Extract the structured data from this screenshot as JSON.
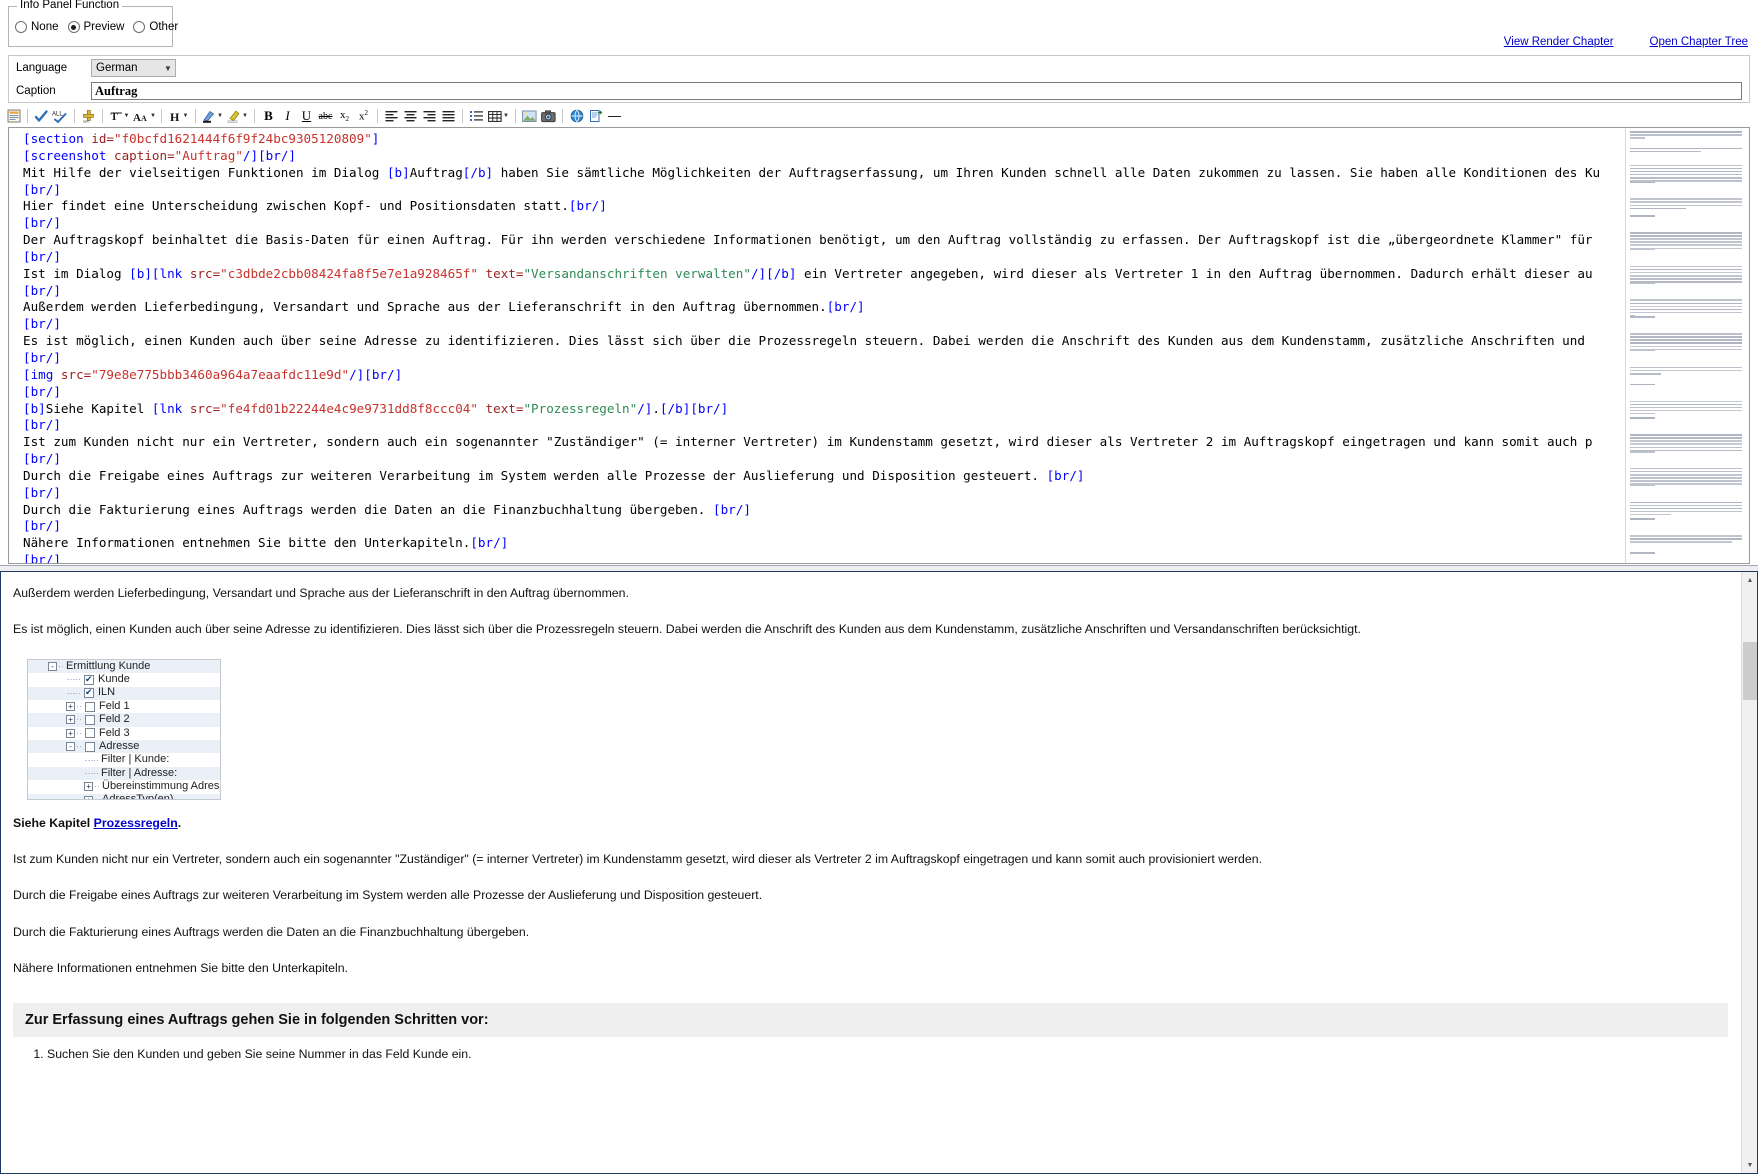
{
  "info_panel": {
    "group_title": "Info Panel Function",
    "options": [
      {
        "label": "None",
        "selected": false
      },
      {
        "label": "Preview",
        "selected": true
      },
      {
        "label": "Other",
        "selected": false
      }
    ]
  },
  "top_links": [
    {
      "label": "View Render Chapter"
    },
    {
      "label": "Open Chapter Tree"
    }
  ],
  "form": {
    "language_label": "Language",
    "language_value": "German",
    "caption_label": "Caption",
    "caption_value": "Auftrag",
    "caption_placeholder": ""
  },
  "toolbar": {
    "buttons": [
      {
        "name": "insert-section-icon",
        "title": "Insert Section"
      },
      {
        "name": "spellcheck-icon",
        "title": "Spell Check"
      },
      {
        "name": "spellcheck-all-icon",
        "title": "Spell Check All"
      },
      {
        "name": "insert-section-marker-icon",
        "title": "Insert Section Marker"
      },
      {
        "name": "font-color-icon",
        "title": "Font"
      },
      {
        "name": "font-size-icon",
        "title": "Font Size"
      },
      {
        "name": "heading-icon",
        "title": "Heading"
      },
      {
        "name": "highlight-pen-icon",
        "title": "Highlight"
      },
      {
        "name": "text-highlight-icon",
        "title": "Text Highlight Color"
      },
      {
        "name": "bold-icon",
        "title": "Bold",
        "glyph": "B"
      },
      {
        "name": "italic-icon",
        "title": "Italic",
        "glyph": "I"
      },
      {
        "name": "underline-icon",
        "title": "Underline",
        "glyph": "U"
      },
      {
        "name": "strikethrough-icon",
        "title": "Strikethrough",
        "glyph": "abc"
      },
      {
        "name": "subscript-icon",
        "title": "Subscript",
        "glyph": "x₂"
      },
      {
        "name": "superscript-icon",
        "title": "Superscript",
        "glyph": "x²"
      },
      {
        "name": "align-left-icon",
        "title": "Align Left"
      },
      {
        "name": "align-center-icon",
        "title": "Align Center"
      },
      {
        "name": "align-right-icon",
        "title": "Align Right"
      },
      {
        "name": "align-justify-icon",
        "title": "Justify"
      },
      {
        "name": "bullet-list-icon",
        "title": "Bullet List"
      },
      {
        "name": "table-icon",
        "title": "Insert Table"
      },
      {
        "name": "insert-image-icon",
        "title": "Insert Image"
      },
      {
        "name": "insert-screenshot-icon",
        "title": "Insert Screenshot"
      },
      {
        "name": "insert-link-icon",
        "title": "Insert Link"
      },
      {
        "name": "insert-reference-icon",
        "title": "Insert Reference"
      },
      {
        "name": "horizontal-rule-icon",
        "title": "Horizontal Rule",
        "glyph": "—"
      }
    ]
  },
  "editor": {
    "lines": [
      [
        {
          "t": "tag",
          "v": "[section "
        },
        {
          "t": "attr",
          "v": "id="
        },
        {
          "t": "str",
          "v": "\"f0bcfd1621444f6f9f24bc9305120809\""
        },
        {
          "t": "tag",
          "v": "]"
        }
      ],
      [
        {
          "t": "tag",
          "v": "[screenshot "
        },
        {
          "t": "attr",
          "v": "caption="
        },
        {
          "t": "str",
          "v": "\"Auftrag\""
        },
        {
          "t": "tag",
          "v": "/]"
        },
        {
          "t": "br",
          "v": "[br/]"
        }
      ],
      [
        {
          "t": "plain",
          "v": "Mit Hilfe der vielseitigen Funktionen im Dialog "
        },
        {
          "t": "br",
          "v": "[b]"
        },
        {
          "t": "plain",
          "v": "Auftrag"
        },
        {
          "t": "br",
          "v": "[/b]"
        },
        {
          "t": "plain",
          "v": " haben Sie sämtliche Möglichkeiten der Auftragserfassung, um Ihren Kunden schnell alle Daten zukommen zu lassen. Sie haben alle Konditionen des Ku"
        }
      ],
      [
        {
          "t": "br",
          "v": "[br/]"
        }
      ],
      [
        {
          "t": "plain",
          "v": "Hier findet eine Unterscheidung zwischen Kopf- und Positionsdaten statt."
        },
        {
          "t": "br",
          "v": "[br/]"
        }
      ],
      [
        {
          "t": "br",
          "v": "[br/]"
        }
      ],
      [
        {
          "t": "plain",
          "v": "Der Auftragskopf beinhaltet die Basis-Daten für einen Auftrag. Für ihn werden verschiedene Informationen benötigt, um den Auftrag vollständig zu erfassen. Der Auftragskopf ist die „übergeordnete Klammer\" für"
        }
      ],
      [
        {
          "t": "br",
          "v": "[br/]"
        }
      ],
      [
        {
          "t": "plain",
          "v": "Ist im Dialog "
        },
        {
          "t": "br",
          "v": "[b]"
        },
        {
          "t": "tag",
          "v": "[lnk "
        },
        {
          "t": "attr",
          "v": "src="
        },
        {
          "t": "str",
          "v": "\"c3dbde2cbb08424fa8f5e7e1a928465f\""
        },
        {
          "t": "attr",
          "v": " text="
        },
        {
          "t": "strg",
          "v": "\"Versandanschriften verwalten\""
        },
        {
          "t": "tag",
          "v": "/]"
        },
        {
          "t": "br",
          "v": "[/b]"
        },
        {
          "t": "plain",
          "v": " ein Vertreter angegeben, wird dieser als Vertreter 1 in den Auftrag übernommen. Dadurch erhält dieser au"
        }
      ],
      [
        {
          "t": "br",
          "v": "[br/]"
        }
      ],
      [
        {
          "t": "plain",
          "v": "Außerdem werden Lieferbedingung, Versandart und Sprache aus der Lieferanschrift in den Auftrag übernommen."
        },
        {
          "t": "br",
          "v": "[br/]"
        }
      ],
      [
        {
          "t": "br",
          "v": "[br/]"
        }
      ],
      [
        {
          "t": "plain",
          "v": "Es ist möglich, einen Kunden auch über seine Adresse zu identifizieren. Dies lässt sich über die Prozessregeln steuern. Dabei werden die Anschrift des Kunden aus dem Kundenstamm, zusätzliche Anschriften und"
        }
      ],
      [
        {
          "t": "br",
          "v": "[br/]"
        }
      ],
      [
        {
          "t": "tag",
          "v": "[img "
        },
        {
          "t": "attr",
          "v": "src="
        },
        {
          "t": "str",
          "v": "\"79e8e775bbb3460a964a7eaafdc11e9d\""
        },
        {
          "t": "tag",
          "v": "/]"
        },
        {
          "t": "br",
          "v": "[br/]"
        }
      ],
      [
        {
          "t": "br",
          "v": "[br/]"
        }
      ],
      [
        {
          "t": "br",
          "v": "[b]"
        },
        {
          "t": "plain",
          "v": "Siehe Kapitel "
        },
        {
          "t": "tag",
          "v": "[lnk "
        },
        {
          "t": "attr",
          "v": "src="
        },
        {
          "t": "str",
          "v": "\"fe4fd01b22244e4c9e9731dd8f8ccc04\""
        },
        {
          "t": "attr",
          "v": " text="
        },
        {
          "t": "strg",
          "v": "\"Prozessregeln\""
        },
        {
          "t": "tag",
          "v": "/]"
        },
        {
          "t": "plain",
          "v": "."
        },
        {
          "t": "br",
          "v": "[/b]"
        },
        {
          "t": "br",
          "v": "[br/]"
        }
      ],
      [
        {
          "t": "br",
          "v": "[br/]"
        }
      ],
      [
        {
          "t": "plain",
          "v": "Ist zum Kunden nicht nur ein Vertreter, sondern auch ein sogenannter \"Zuständiger\" (= interner Vertreter) im Kundenstamm gesetzt, wird dieser als Vertreter 2 im Auftragskopf eingetragen und kann somit auch p"
        }
      ],
      [
        {
          "t": "br",
          "v": "[br/]"
        }
      ],
      [
        {
          "t": "plain",
          "v": "Durch die Freigabe eines Auftrags zur weiteren Verarbeitung im System werden alle Prozesse der Auslieferung und Disposition gesteuert. "
        },
        {
          "t": "br",
          "v": "[br/]"
        }
      ],
      [
        {
          "t": "br",
          "v": "[br/]"
        }
      ],
      [
        {
          "t": "plain",
          "v": "Durch die Fakturierung eines Auftrags werden die Daten an die Finanzbuchhaltung übergeben. "
        },
        {
          "t": "br",
          "v": "[br/]"
        }
      ],
      [
        {
          "t": "br",
          "v": "[br/]"
        }
      ],
      [
        {
          "t": "plain",
          "v": "Nähere Informationen entnehmen Sie bitte den Unterkapiteln."
        },
        {
          "t": "br",
          "v": "[br/]"
        }
      ],
      [
        {
          "t": "br",
          "v": "[br/]"
        }
      ]
    ]
  },
  "preview": {
    "paragraphs": [
      "Außerdem werden Lieferbedingung, Versandart und Sprache aus der Lieferanschrift in den Auftrag übernommen.",
      "Es ist möglich, einen Kunden auch über seine Adresse zu identifizieren. Dies lässt sich über die Prozessregeln steuern. Dabei werden die Anschrift des Kunden aus dem Kundenstamm, zusätzliche Anschriften und Versandanschriften berücksichtigt."
    ],
    "siehe_prefix": "Siehe Kapitel ",
    "siehe_link": "Prozessregeln",
    "siehe_suffix": ".",
    "paragraphs2": [
      "Ist zum Kunden nicht nur ein Vertreter, sondern auch ein sogenannter \"Zuständiger\" (= interner Vertreter) im Kundenstamm gesetzt, wird dieser als Vertreter 2 im Auftragskopf eingetragen und kann somit auch provisioniert werden.",
      "Durch die Freigabe eines Auftrags zur weiteren Verarbeitung im System werden alle Prozesse der Auslieferung und Disposition gesteuert.",
      "Durch die Fakturierung eines Auftrags werden die Daten an die Finanzbuchhaltung übergeben.",
      "Nähere Informationen entnehmen Sie bitte den Unterkapiteln."
    ],
    "section_header": "Zur Erfassung eines Auftrags gehen Sie in folgenden Schritten vor:",
    "steps": [
      "Suchen Sie den Kunden und geben Sie seine Nummer in das Feld Kunde ein."
    ],
    "tree": [
      {
        "label": "Ermittlung Kunde",
        "indent": 0,
        "expander": "-",
        "checkbox": null,
        "alt": true
      },
      {
        "label": "Kunde",
        "indent": 1,
        "expander": null,
        "checkbox": "checked",
        "alt": false
      },
      {
        "label": "ILN",
        "indent": 1,
        "expander": null,
        "checkbox": "checked",
        "alt": true
      },
      {
        "label": "Feld 1",
        "indent": 1,
        "expander": "+",
        "checkbox": "unchecked",
        "alt": false
      },
      {
        "label": "Feld 2",
        "indent": 1,
        "expander": "+",
        "checkbox": "unchecked",
        "alt": true
      },
      {
        "label": "Feld 3",
        "indent": 1,
        "expander": "+",
        "checkbox": "unchecked",
        "alt": false
      },
      {
        "label": "Adresse",
        "indent": 1,
        "expander": "-",
        "checkbox": "unchecked",
        "alt": true
      },
      {
        "label": "Filter | Kunde:",
        "indent": 2,
        "expander": null,
        "checkbox": null,
        "alt": false
      },
      {
        "label": "Filter | Adresse:",
        "indent": 2,
        "expander": null,
        "checkbox": null,
        "alt": true
      },
      {
        "label": "Übereinstimmung Adresse",
        "indent": 2,
        "expander": "+",
        "checkbox": null,
        "alt": false
      },
      {
        "label": "AdressTyp(en)",
        "indent": 2,
        "expander": "+",
        "checkbox": null,
        "alt": true
      }
    ]
  },
  "colors": {
    "link": "#0000cd",
    "tag": "#0000ff",
    "attr": "#9b1f1f",
    "string": "#c8322b",
    "string_green": "#2e8b57",
    "splitter_border": "#1f3864",
    "tree_alt_row": "#eaf0f8"
  }
}
